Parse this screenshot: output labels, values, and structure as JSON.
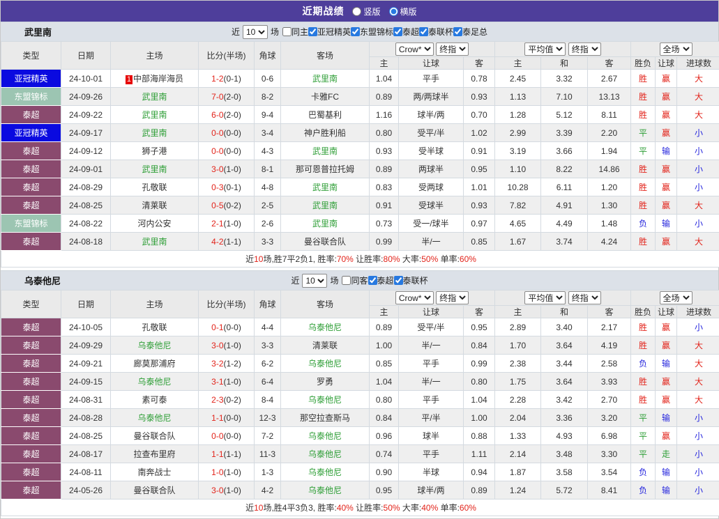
{
  "title_bar": {
    "title": "近期战绩",
    "radios": [
      {
        "label": "竖版",
        "checked": false
      },
      {
        "label": "横版",
        "checked": true
      }
    ]
  },
  "columns": {
    "left": [
      "类型",
      "日期",
      "主场",
      "比分(半场)",
      "角球",
      "客场"
    ],
    "sub": [
      "主",
      "让球",
      "客",
      "主",
      "和",
      "客",
      "胜负",
      "让球",
      "进球数"
    ],
    "dropdowns": {
      "crow": "Crow*",
      "final1": "终指",
      "avg": "平均值",
      "final2": "终指",
      "full": "全场"
    }
  },
  "type_colors": {
    "亚冠精英": "#0a0ae0",
    "东盟锦标": "#9cc5b2",
    "泰超": "#8a4a6e"
  },
  "filter_labels": {
    "recent": "近",
    "games": "场"
  },
  "sections": [
    {
      "team": "武里南",
      "filter": {
        "count": "10",
        "same_label": "同主",
        "same_checked": false,
        "leagues": [
          {
            "label": "亚冠精英",
            "checked": true
          },
          {
            "label": "东盟锦标",
            "checked": true
          },
          {
            "label": "泰超",
            "checked": true
          },
          {
            "label": "泰联杯",
            "checked": true
          },
          {
            "label": "泰足总",
            "checked": true
          }
        ]
      },
      "rows": [
        {
          "type": "亚冠精英",
          "date": "24-10-01",
          "home": "中部海岸海员",
          "home_rank": "1",
          "home_focus": false,
          "score": "1-2",
          "half": "(0-1)",
          "corner": "0-6",
          "away": "武里南",
          "away_focus": true,
          "odds": [
            "1.04",
            "平手",
            "0.78"
          ],
          "avg": [
            "2.45",
            "3.32",
            "2.67"
          ],
          "result": [
            [
              "胜",
              "r"
            ],
            [
              "赢",
              "r"
            ],
            [
              "大",
              "r"
            ]
          ]
        },
        {
          "type": "东盟锦标",
          "date": "24-09-26",
          "home": "武里南",
          "home_focus": true,
          "score": "7-0",
          "half": "(2-0)",
          "corner": "8-2",
          "away": "卡雅FC",
          "away_focus": false,
          "odds": [
            "0.89",
            "两/两球半",
            "0.93"
          ],
          "avg": [
            "1.13",
            "7.10",
            "13.13"
          ],
          "result": [
            [
              "胜",
              "r"
            ],
            [
              "赢",
              "r"
            ],
            [
              "大",
              "r"
            ]
          ]
        },
        {
          "type": "泰超",
          "date": "24-09-22",
          "home": "武里南",
          "home_focus": true,
          "score": "6-0",
          "half": "(2-0)",
          "corner": "9-4",
          "away": "巴蜀基利",
          "away_focus": false,
          "odds": [
            "1.16",
            "球半/两",
            "0.70"
          ],
          "avg": [
            "1.28",
            "5.12",
            "8.11"
          ],
          "result": [
            [
              "胜",
              "r"
            ],
            [
              "赢",
              "r"
            ],
            [
              "大",
              "r"
            ]
          ]
        },
        {
          "type": "亚冠精英",
          "date": "24-09-17",
          "home": "武里南",
          "home_focus": true,
          "score": "0-0",
          "half": "(0-0)",
          "corner": "3-4",
          "away": "神户胜利船",
          "away_focus": false,
          "odds": [
            "0.80",
            "受平/半",
            "1.02"
          ],
          "avg": [
            "2.99",
            "3.39",
            "2.20"
          ],
          "result": [
            [
              "平",
              "g"
            ],
            [
              "赢",
              "r"
            ],
            [
              "小",
              "b"
            ]
          ]
        },
        {
          "type": "泰超",
          "date": "24-09-12",
          "home": "狮子港",
          "home_focus": false,
          "score": "0-0",
          "half": "(0-0)",
          "corner": "4-3",
          "away": "武里南",
          "away_focus": true,
          "odds": [
            "0.93",
            "受半球",
            "0.91"
          ],
          "avg": [
            "3.19",
            "3.66",
            "1.94"
          ],
          "result": [
            [
              "平",
              "g"
            ],
            [
              "输",
              "b"
            ],
            [
              "小",
              "b"
            ]
          ]
        },
        {
          "type": "泰超",
          "date": "24-09-01",
          "home": "武里南",
          "home_focus": true,
          "score": "3-0",
          "half": "(1-0)",
          "corner": "8-1",
          "away": "那可恩普拉托姆",
          "away_focus": false,
          "odds": [
            "0.89",
            "两球半",
            "0.95"
          ],
          "avg": [
            "1.10",
            "8.22",
            "14.86"
          ],
          "result": [
            [
              "胜",
              "r"
            ],
            [
              "赢",
              "r"
            ],
            [
              "小",
              "b"
            ]
          ]
        },
        {
          "type": "泰超",
          "date": "24-08-29",
          "home": "孔敬联",
          "home_focus": false,
          "score": "0-3",
          "half": "(0-1)",
          "corner": "4-8",
          "away": "武里南",
          "away_focus": true,
          "odds": [
            "0.83",
            "受两球",
            "1.01"
          ],
          "avg": [
            "10.28",
            "6.11",
            "1.20"
          ],
          "result": [
            [
              "胜",
              "r"
            ],
            [
              "赢",
              "r"
            ],
            [
              "小",
              "b"
            ]
          ]
        },
        {
          "type": "泰超",
          "date": "24-08-25",
          "home": "清莱联",
          "home_focus": false,
          "score": "0-5",
          "half": "(0-2)",
          "corner": "2-5",
          "away": "武里南",
          "away_focus": true,
          "odds": [
            "0.91",
            "受球半",
            "0.93"
          ],
          "avg": [
            "7.82",
            "4.91",
            "1.30"
          ],
          "result": [
            [
              "胜",
              "r"
            ],
            [
              "赢",
              "r"
            ],
            [
              "大",
              "r"
            ]
          ]
        },
        {
          "type": "东盟锦标",
          "date": "24-08-22",
          "home": "河内公安",
          "home_focus": false,
          "score": "2-1",
          "half": "(1-0)",
          "corner": "2-6",
          "away": "武里南",
          "away_focus": true,
          "odds": [
            "0.73",
            "受一/球半",
            "0.97"
          ],
          "avg": [
            "4.65",
            "4.49",
            "1.48"
          ],
          "result": [
            [
              "负",
              "b"
            ],
            [
              "输",
              "b"
            ],
            [
              "小",
              "b"
            ]
          ]
        },
        {
          "type": "泰超",
          "date": "24-08-18",
          "home": "武里南",
          "home_focus": true,
          "score": "4-2",
          "half": "(1-1)",
          "corner": "3-3",
          "away": "曼谷联合队",
          "away_focus": false,
          "odds": [
            "0.99",
            "半/一",
            "0.85"
          ],
          "avg": [
            "1.67",
            "3.74",
            "4.24"
          ],
          "result": [
            [
              "胜",
              "r"
            ],
            [
              "赢",
              "r"
            ],
            [
              "大",
              "r"
            ]
          ]
        }
      ],
      "summary": [
        [
          "近",
          "k"
        ],
        [
          "10",
          "r"
        ],
        [
          "场,胜7平2负1, 胜率:",
          "k"
        ],
        [
          "70%",
          "r"
        ],
        [
          " 让胜率:",
          "k"
        ],
        [
          "80%",
          "r"
        ],
        [
          " 大率:",
          "k"
        ],
        [
          "50%",
          "r"
        ],
        [
          " 单率:",
          "k"
        ],
        [
          "60%",
          "r"
        ]
      ]
    },
    {
      "team": "乌泰他尼",
      "filter": {
        "count": "10",
        "same_label": "同客",
        "same_checked": false,
        "leagues": [
          {
            "label": "泰超",
            "checked": true
          },
          {
            "label": "泰联杯",
            "checked": true
          }
        ]
      },
      "rows": [
        {
          "type": "泰超",
          "date": "24-10-05",
          "home": "孔敬联",
          "home_focus": false,
          "score": "0-1",
          "half": "(0-0)",
          "corner": "4-4",
          "away": "乌泰他尼",
          "away_focus": true,
          "odds": [
            "0.89",
            "受平/半",
            "0.95"
          ],
          "avg": [
            "2.89",
            "3.40",
            "2.17"
          ],
          "result": [
            [
              "胜",
              "r"
            ],
            [
              "赢",
              "r"
            ],
            [
              "小",
              "b"
            ]
          ]
        },
        {
          "type": "泰超",
          "date": "24-09-29",
          "home": "乌泰他尼",
          "home_focus": true,
          "score": "3-0",
          "half": "(1-0)",
          "corner": "3-3",
          "away": "清莱联",
          "away_focus": false,
          "odds": [
            "1.00",
            "半/一",
            "0.84"
          ],
          "avg": [
            "1.70",
            "3.64",
            "4.19"
          ],
          "result": [
            [
              "胜",
              "r"
            ],
            [
              "赢",
              "r"
            ],
            [
              "大",
              "r"
            ]
          ]
        },
        {
          "type": "泰超",
          "date": "24-09-21",
          "home": "廊莫那浦府",
          "home_focus": false,
          "score": "3-2",
          "half": "(1-2)",
          "corner": "6-2",
          "away": "乌泰他尼",
          "away_focus": true,
          "odds": [
            "0.85",
            "平手",
            "0.99"
          ],
          "avg": [
            "2.38",
            "3.44",
            "2.58"
          ],
          "result": [
            [
              "负",
              "b"
            ],
            [
              "输",
              "b"
            ],
            [
              "大",
              "r"
            ]
          ]
        },
        {
          "type": "泰超",
          "date": "24-09-15",
          "home": "乌泰他尼",
          "home_focus": true,
          "score": "3-1",
          "half": "(1-0)",
          "corner": "6-4",
          "away": "罗勇",
          "away_focus": false,
          "odds": [
            "1.04",
            "半/一",
            "0.80"
          ],
          "avg": [
            "1.75",
            "3.64",
            "3.93"
          ],
          "result": [
            [
              "胜",
              "r"
            ],
            [
              "赢",
              "r"
            ],
            [
              "大",
              "r"
            ]
          ]
        },
        {
          "type": "泰超",
          "date": "24-08-31",
          "home": "素可泰",
          "home_focus": false,
          "score": "2-3",
          "half": "(0-2)",
          "corner": "8-4",
          "away": "乌泰他尼",
          "away_focus": true,
          "odds": [
            "0.80",
            "平手",
            "1.04"
          ],
          "avg": [
            "2.28",
            "3.42",
            "2.70"
          ],
          "result": [
            [
              "胜",
              "r"
            ],
            [
              "赢",
              "r"
            ],
            [
              "大",
              "r"
            ]
          ]
        },
        {
          "type": "泰超",
          "date": "24-08-28",
          "home": "乌泰他尼",
          "home_focus": true,
          "score": "1-1",
          "half": "(0-0)",
          "corner": "12-3",
          "away": "那空拉查斯马",
          "away_focus": false,
          "odds": [
            "0.84",
            "平/半",
            "1.00"
          ],
          "avg": [
            "2.04",
            "3.36",
            "3.20"
          ],
          "result": [
            [
              "平",
              "g"
            ],
            [
              "输",
              "b"
            ],
            [
              "小",
              "b"
            ]
          ]
        },
        {
          "type": "泰超",
          "date": "24-08-25",
          "home": "曼谷联合队",
          "home_focus": false,
          "score": "0-0",
          "half": "(0-0)",
          "corner": "7-2",
          "away": "乌泰他尼",
          "away_focus": true,
          "odds": [
            "0.96",
            "球半",
            "0.88"
          ],
          "avg": [
            "1.33",
            "4.93",
            "6.98"
          ],
          "result": [
            [
              "平",
              "g"
            ],
            [
              "赢",
              "r"
            ],
            [
              "小",
              "b"
            ]
          ]
        },
        {
          "type": "泰超",
          "date": "24-08-17",
          "home": "拉查布里府",
          "home_focus": false,
          "score": "1-1",
          "half": "(1-1)",
          "corner": "11-3",
          "away": "乌泰他尼",
          "away_focus": true,
          "odds": [
            "0.74",
            "平手",
            "1.11"
          ],
          "avg": [
            "2.14",
            "3.48",
            "3.30"
          ],
          "result": [
            [
              "平",
              "g"
            ],
            [
              "走",
              "g"
            ],
            [
              "小",
              "b"
            ]
          ]
        },
        {
          "type": "泰超",
          "date": "24-08-11",
          "home": "南奔战士",
          "home_focus": false,
          "score": "1-0",
          "half": "(1-0)",
          "corner": "1-3",
          "away": "乌泰他尼",
          "away_focus": true,
          "odds": [
            "0.90",
            "半球",
            "0.94"
          ],
          "avg": [
            "1.87",
            "3.58",
            "3.54"
          ],
          "result": [
            [
              "负",
              "b"
            ],
            [
              "输",
              "b"
            ],
            [
              "小",
              "b"
            ]
          ]
        },
        {
          "type": "泰超",
          "date": "24-05-26",
          "home": "曼谷联合队",
          "home_focus": false,
          "score": "3-0",
          "half": "(1-0)",
          "corner": "4-2",
          "away": "乌泰他尼",
          "away_focus": true,
          "odds": [
            "0.95",
            "球半/两",
            "0.89"
          ],
          "avg": [
            "1.24",
            "5.72",
            "8.41"
          ],
          "result": [
            [
              "负",
              "b"
            ],
            [
              "输",
              "b"
            ],
            [
              "小",
              "b"
            ]
          ]
        }
      ],
      "summary": [
        [
          "近",
          "k"
        ],
        [
          "10",
          "r"
        ],
        [
          "场,胜4平3负3, 胜率:",
          "k"
        ],
        [
          "40%",
          "r"
        ],
        [
          " 让胜率:",
          "k"
        ],
        [
          "50%",
          "r"
        ],
        [
          " 大率:",
          "k"
        ],
        [
          "40%",
          "r"
        ],
        [
          " 单率:",
          "k"
        ],
        [
          "60%",
          "r"
        ]
      ]
    }
  ]
}
